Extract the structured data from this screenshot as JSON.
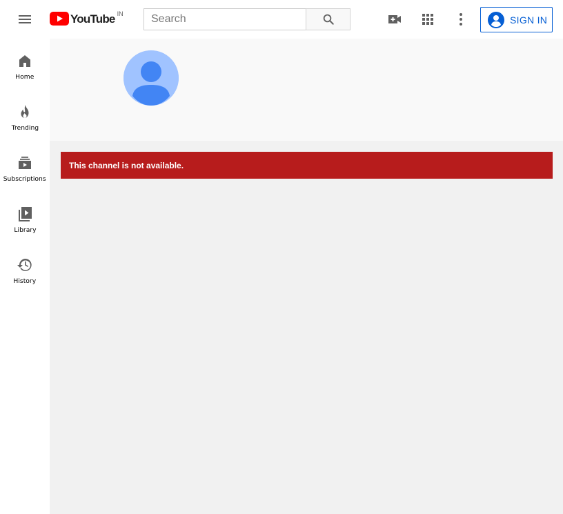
{
  "header": {
    "logo_text": "YouTube",
    "country_code": "IN",
    "search_placeholder": "Search",
    "signin_label": "SIGN IN",
    "icons": [
      "menu-icon",
      "search-icon",
      "create-video-icon",
      "apps-icon",
      "more-vert-icon",
      "account-icon"
    ]
  },
  "sidebar": {
    "items": [
      {
        "label": "Home",
        "icon": "home-icon"
      },
      {
        "label": "Trending",
        "icon": "trending-icon"
      },
      {
        "label": "Subscriptions",
        "icon": "subscriptions-icon"
      },
      {
        "label": "Library",
        "icon": "library-icon"
      },
      {
        "label": "History",
        "icon": "history-icon"
      }
    ]
  },
  "main": {
    "alert_message": "This channel is not available."
  },
  "colors": {
    "brand_red": "#ff0000",
    "alert_red": "#b71c1c",
    "link_blue": "#065fd4",
    "avatar_bg": "#a0c3ff",
    "avatar_fg": "#4285f4"
  }
}
